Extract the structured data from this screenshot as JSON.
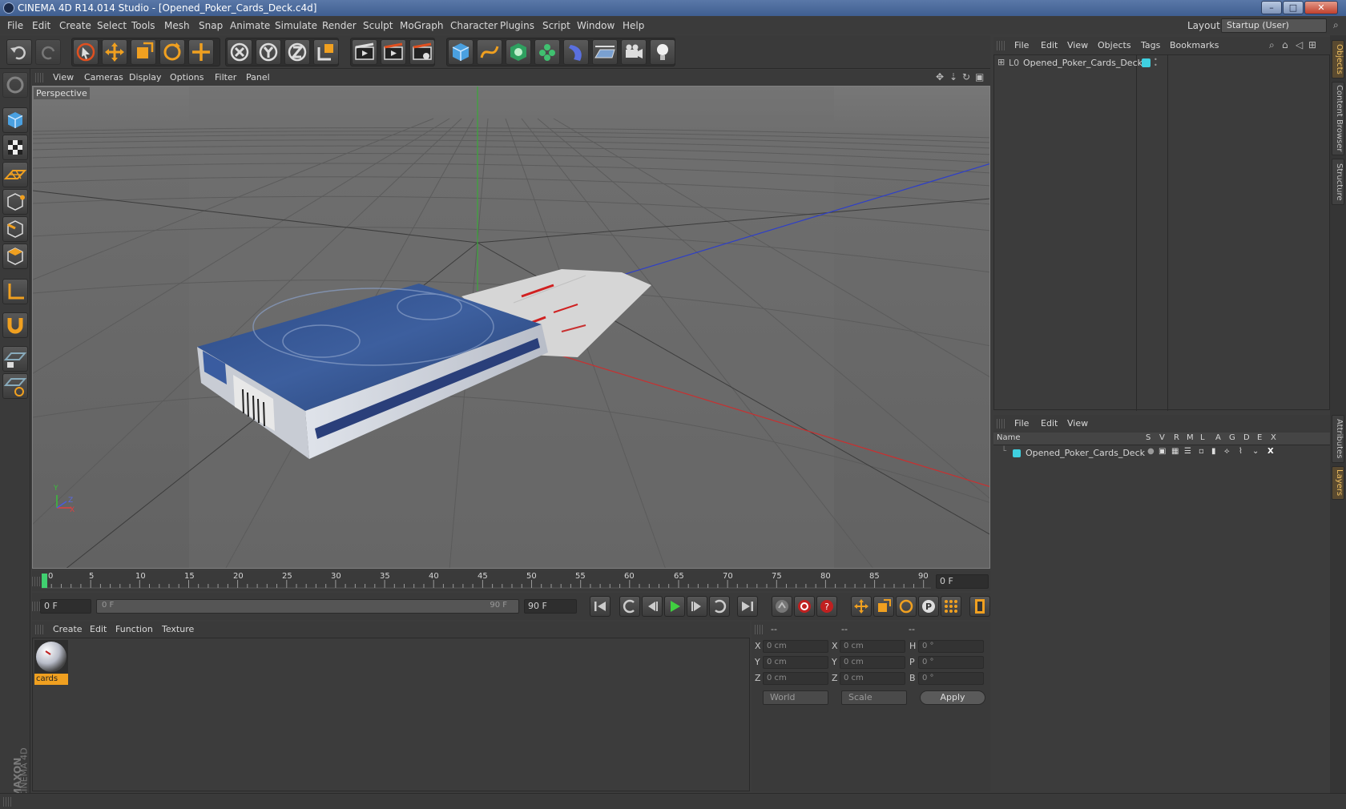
{
  "window": {
    "title": "CINEMA 4D R14.014 Studio - [Opened_Poker_Cards_Deck.c4d]",
    "minimize": "–",
    "maximize": "□",
    "close": "✕"
  },
  "menubar": {
    "items": [
      "File",
      "Edit",
      "Create",
      "Select",
      "Tools",
      "Mesh",
      "Snap",
      "Animate",
      "Simulate",
      "Render",
      "Sculpt",
      "MoGraph",
      "Character",
      "Plugins",
      "Script",
      "Window",
      "Help"
    ],
    "layout_label": "Layout:",
    "layout_value": "Startup (User)"
  },
  "viewport": {
    "menu": [
      "View",
      "Cameras",
      "Display",
      "Options",
      "Filter",
      "Panel"
    ],
    "label": "Perspective",
    "axis_y": "Y",
    "axis_z": "Z",
    "axis_x": "X"
  },
  "timeline": {
    "ticks": [
      "0",
      "5",
      "10",
      "15",
      "20",
      "25",
      "30",
      "35",
      "40",
      "45",
      "50",
      "55",
      "60",
      "65",
      "70",
      "75",
      "80",
      "85",
      "90"
    ],
    "current_frame": "0 F",
    "start_field": "0 F",
    "range_start": "0 F",
    "range_end": "90 F",
    "end_field": "90 F"
  },
  "materials": {
    "menu": [
      "Create",
      "Edit",
      "Function",
      "Texture"
    ],
    "items": [
      {
        "name": "cards"
      }
    ]
  },
  "coords": {
    "headers": [
      "--",
      "--",
      "--"
    ],
    "rows": [
      {
        "a_label": "X",
        "a_val": "0 cm",
        "b_label": "X",
        "b_val": "0 cm",
        "c_label": "H",
        "c_val": "0 °"
      },
      {
        "a_label": "Y",
        "a_val": "0 cm",
        "b_label": "Y",
        "b_val": "0 cm",
        "c_label": "P",
        "c_val": "0 °"
      },
      {
        "a_label": "Z",
        "a_val": "0 cm",
        "b_label": "Z",
        "b_val": "0 cm",
        "c_label": "B",
        "c_val": "0 °"
      }
    ],
    "space": "World",
    "mode": "Scale",
    "apply": "Apply"
  },
  "objects": {
    "menu": [
      "File",
      "Edit",
      "View",
      "Objects",
      "Tags",
      "Bookmarks"
    ],
    "items": [
      {
        "name": "Opened_Poker_Cards_Deck",
        "layer_color": "#3fd0e0"
      }
    ]
  },
  "layers": {
    "menu": [
      "File",
      "Edit",
      "View"
    ],
    "columns": [
      "Name",
      "S",
      "V",
      "R",
      "M",
      "L",
      "A",
      "G",
      "D",
      "E",
      "X"
    ],
    "items": [
      {
        "name": "Opened_Poker_Cards_Deck",
        "color": "#3fd0e0"
      }
    ]
  },
  "sidetabs": [
    "Objects",
    "Content Browser",
    "Structure",
    "Attributes",
    "Layers"
  ],
  "brand": {
    "maxon": "MAXON",
    "product": "CINEMA 4D"
  },
  "colors": {
    "accent_orange": "#f0a020",
    "axis_x": "#c83030",
    "axis_y": "#30c030",
    "axis_z": "#3050d0"
  }
}
